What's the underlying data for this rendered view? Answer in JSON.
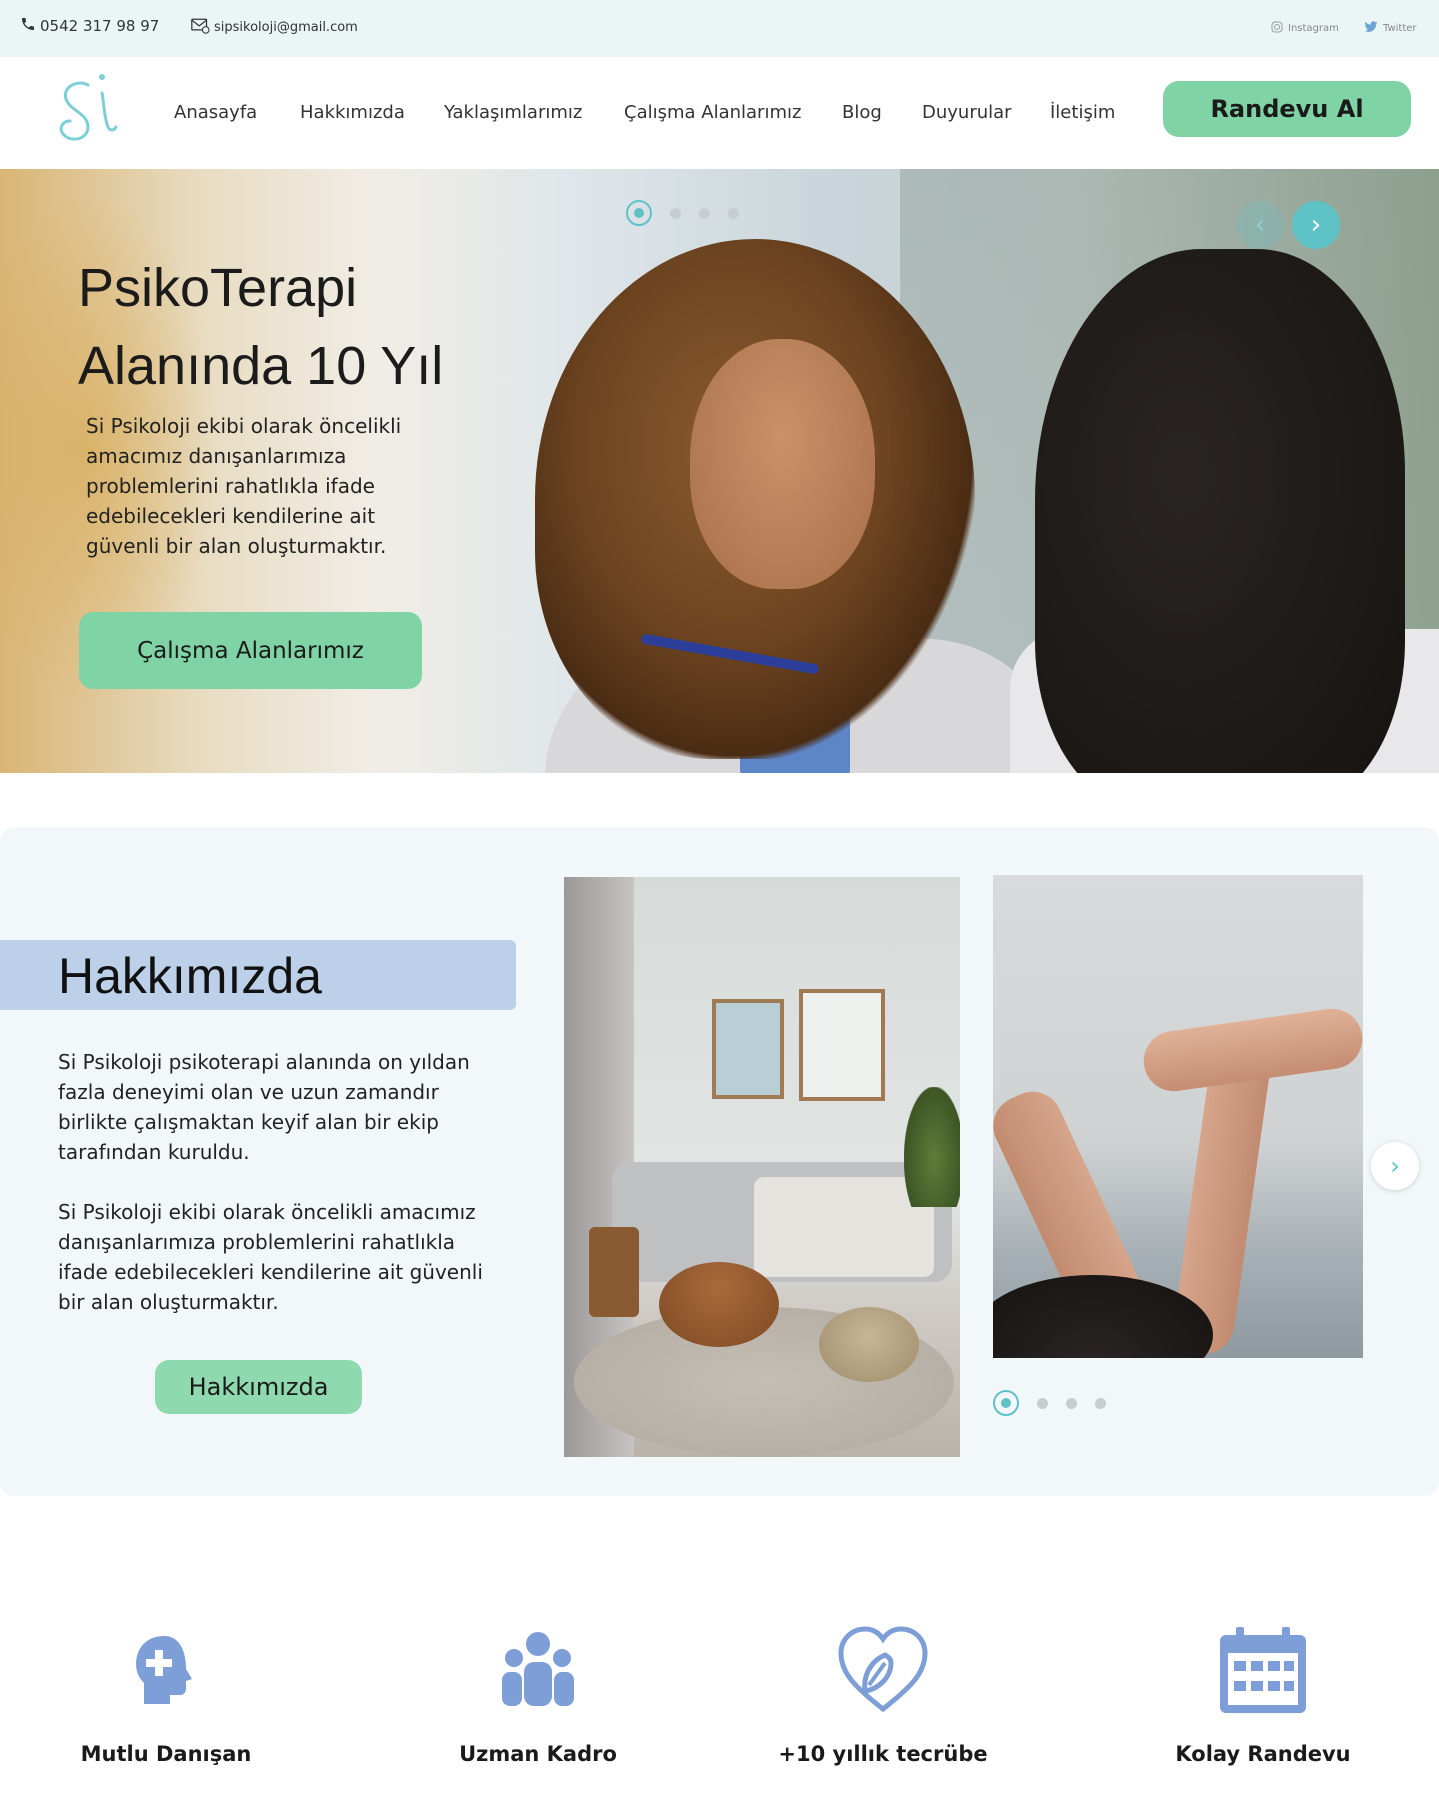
{
  "topbar": {
    "phone": "0542 317 98 97",
    "email": "sipsikoloji@gmail.com",
    "instagram": "Instagram",
    "twitter": "Twitter"
  },
  "nav": {
    "logo_text": "Si",
    "items": [
      "Anasayfa",
      "Hakkımızda",
      "Yaklaşımlarımız",
      "Çalışma Alanlarımız",
      "Blog",
      "Duyurular",
      "İletişim"
    ],
    "cta": "Randevu Al"
  },
  "hero": {
    "title_line1": "PsikoTerapi",
    "title_line2": "Alanında 10 Yıl",
    "text": "Si Psikoloji ekibi olarak öncelikli amacımız danışanlarımıza problemlerini rahatlıkla ifade edebilecekleri kendilerine ait güvenli bir alan oluşturmaktır.",
    "button": "Çalışma Alanlarımız"
  },
  "about": {
    "title": "Hakkımızda",
    "para1": "Si Psikoloji psikoterapi alanında on yıldan fazla deneyimi olan ve uzun zamandır birlikte çalışmaktan keyif alan bir ekip tarafından kuruldu.",
    "para2": "Si Psikoloji ekibi olarak öncelikli amacımız danışanlarımıza problemlerini rahatlıkla ifade edebilecekleri kendilerine ait güvenli bir alan oluşturmaktır.",
    "button": "Hakkımızda"
  },
  "features": [
    {
      "label": "Mutlu Danışan",
      "icon": "head-plus-icon"
    },
    {
      "label": "Uzman Kadro",
      "icon": "group-icon"
    },
    {
      "label": "+10 yıllık tecrübe",
      "icon": "heart-leaf-icon"
    },
    {
      "label": "Kolay Randevu",
      "icon": "calendar-icon"
    }
  ],
  "colors": {
    "accent_green": "#7fd3a4",
    "accent_teal": "#5ec2c7",
    "icon_blue": "#7d9ed6",
    "title_bar": "#bcd0e9"
  }
}
